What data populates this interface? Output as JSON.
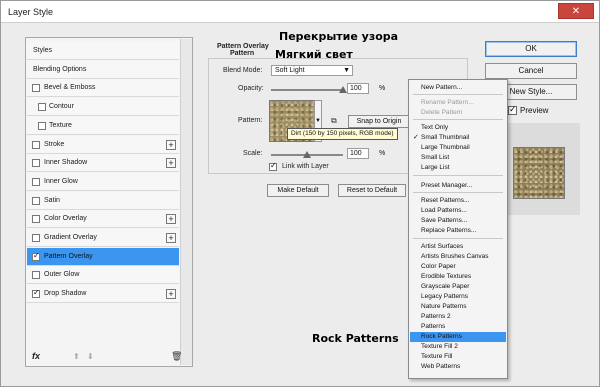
{
  "window": {
    "title": "Layer Style",
    "close_glyph": "✕"
  },
  "styles_list": {
    "items": [
      {
        "label": "Styles",
        "checkbox": false,
        "checked": false,
        "plus": false,
        "selected": false,
        "sub": false
      },
      {
        "label": "Blending Options",
        "checkbox": false,
        "checked": false,
        "plus": false,
        "selected": false,
        "sub": false
      },
      {
        "label": "Bevel & Emboss",
        "checkbox": true,
        "checked": false,
        "plus": false,
        "selected": false,
        "sub": false
      },
      {
        "label": "Contour",
        "checkbox": true,
        "checked": false,
        "plus": false,
        "selected": false,
        "sub": true
      },
      {
        "label": "Texture",
        "checkbox": true,
        "checked": false,
        "plus": false,
        "selected": false,
        "sub": true
      },
      {
        "label": "Stroke",
        "checkbox": true,
        "checked": false,
        "plus": true,
        "selected": false,
        "sub": false
      },
      {
        "label": "Inner Shadow",
        "checkbox": true,
        "checked": false,
        "plus": true,
        "selected": false,
        "sub": false
      },
      {
        "label": "Inner Glow",
        "checkbox": true,
        "checked": false,
        "plus": false,
        "selected": false,
        "sub": false
      },
      {
        "label": "Satin",
        "checkbox": true,
        "checked": false,
        "plus": false,
        "selected": false,
        "sub": false
      },
      {
        "label": "Color Overlay",
        "checkbox": true,
        "checked": false,
        "plus": true,
        "selected": false,
        "sub": false
      },
      {
        "label": "Gradient Overlay",
        "checkbox": true,
        "checked": false,
        "plus": true,
        "selected": false,
        "sub": false
      },
      {
        "label": "Pattern Overlay",
        "checkbox": true,
        "checked": true,
        "plus": false,
        "selected": true,
        "sub": false
      },
      {
        "label": "Outer Glow",
        "checkbox": true,
        "checked": false,
        "plus": false,
        "selected": false,
        "sub": false
      },
      {
        "label": "Drop Shadow",
        "checkbox": true,
        "checked": true,
        "plus": true,
        "selected": false,
        "sub": false
      }
    ],
    "footer": {
      "fx": "fx",
      "up": "⬆",
      "down": "⬇",
      "trash": "🗑"
    }
  },
  "pattern_overlay": {
    "group_title": "Pattern Overlay",
    "sub_title": "Pattern",
    "blend_mode_label": "Blend Mode:",
    "blend_mode_value": "Soft Light",
    "opacity_label": "Opacity:",
    "opacity_value": "100",
    "pct": "%",
    "pattern_label": "Pattern:",
    "snap_to_origin": "Snap to Origin",
    "scale_label": "Scale:",
    "scale_value": "100",
    "link_with_layer": "Link with Layer",
    "make_default": "Make Default",
    "reset_to_default": "Reset to Default",
    "tooltip": "Dirt (150 by 150 pixels, RGB mode)",
    "opacity_level": 1.0,
    "scale_level": 0.5
  },
  "right_buttons": {
    "ok": "OK",
    "cancel": "Cancel",
    "new_style": "New Style...",
    "preview": "Preview"
  },
  "context_menu": {
    "items": [
      {
        "label": "New Pattern...",
        "disabled": false,
        "checked": false,
        "highlighted": false
      },
      {
        "label": "Rename Pattern...",
        "disabled": true,
        "checked": false,
        "highlighted": false
      },
      {
        "label": "Delete Pattern",
        "disabled": true,
        "checked": false,
        "highlighted": false
      },
      {
        "label": "Text Only",
        "disabled": false,
        "checked": false,
        "highlighted": false
      },
      {
        "label": "Small Thumbnail",
        "disabled": false,
        "checked": true,
        "highlighted": false
      },
      {
        "label": "Large Thumbnail",
        "disabled": false,
        "checked": false,
        "highlighted": false
      },
      {
        "label": "Small List",
        "disabled": false,
        "checked": false,
        "highlighted": false
      },
      {
        "label": "Large List",
        "disabled": false,
        "checked": false,
        "highlighted": false
      },
      {
        "label": "Preset Manager...",
        "disabled": false,
        "checked": false,
        "highlighted": false
      },
      {
        "label": "Reset Patterns...",
        "disabled": false,
        "checked": false,
        "highlighted": false
      },
      {
        "label": "Load Patterns...",
        "disabled": false,
        "checked": false,
        "highlighted": false
      },
      {
        "label": "Save Patterns...",
        "disabled": false,
        "checked": false,
        "highlighted": false
      },
      {
        "label": "Replace Patterns...",
        "disabled": false,
        "checked": false,
        "highlighted": false
      },
      {
        "label": "Artist Surfaces",
        "disabled": false,
        "checked": false,
        "highlighted": false
      },
      {
        "label": "Artists Brushes Canvas",
        "disabled": false,
        "checked": false,
        "highlighted": false
      },
      {
        "label": "Color Paper",
        "disabled": false,
        "checked": false,
        "highlighted": false
      },
      {
        "label": "Erodible Textures",
        "disabled": false,
        "checked": false,
        "highlighted": false
      },
      {
        "label": "Grayscale Paper",
        "disabled": false,
        "checked": false,
        "highlighted": false
      },
      {
        "label": "Legacy Patterns",
        "disabled": false,
        "checked": false,
        "highlighted": false
      },
      {
        "label": "Nature Patterns",
        "disabled": false,
        "checked": false,
        "highlighted": false
      },
      {
        "label": "Patterns 2",
        "disabled": false,
        "checked": false,
        "highlighted": false
      },
      {
        "label": "Patterns",
        "disabled": false,
        "checked": false,
        "highlighted": false
      },
      {
        "label": "Rock Patterns",
        "disabled": false,
        "checked": false,
        "highlighted": true
      },
      {
        "label": "Texture Fill 2",
        "disabled": false,
        "checked": false,
        "highlighted": false
      },
      {
        "label": "Texture Fill",
        "disabled": false,
        "checked": false,
        "highlighted": false
      },
      {
        "label": "Web Patterns",
        "disabled": false,
        "checked": false,
        "highlighted": false
      }
    ]
  },
  "annotations": {
    "overlay_ru": "Перекрытие узора",
    "soft_light_ru": "Мягкий свет",
    "rock_patterns": "Rock Patterns"
  },
  "colors": {
    "selection": "#3c96f0",
    "dialog_bg": "#ececec",
    "close_red": "#c9463d"
  }
}
